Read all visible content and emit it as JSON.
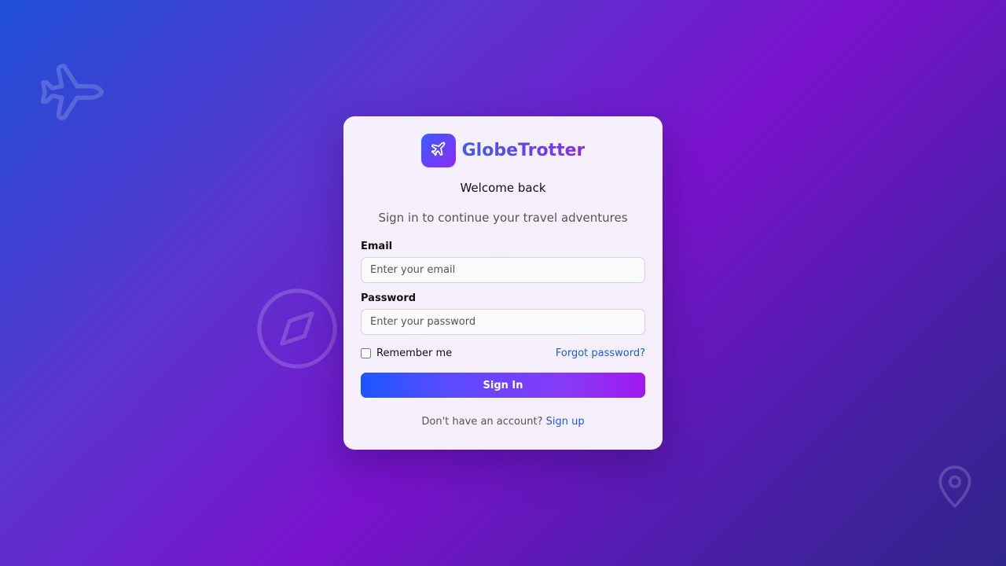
{
  "background": {
    "icons": [
      "airplane-icon",
      "compass-icon",
      "map-pin-icon"
    ],
    "gradient_colors": [
      "#1f4fd6",
      "#5a35cf",
      "#7a12cc",
      "#4a1fa8",
      "#2f2488"
    ]
  },
  "brand": {
    "name": "GlobeTrotter",
    "logo_icon": "airplane-icon",
    "gradient": [
      "#3b5cff",
      "#8b2cf5"
    ]
  },
  "heading": {
    "welcome": "Welcome back",
    "subtitle": "Sign in to continue your travel adventures"
  },
  "form": {
    "email": {
      "label": "Email",
      "value": "",
      "placeholder": "Enter your email"
    },
    "password": {
      "label": "Password",
      "value": "",
      "placeholder": "Enter your password"
    },
    "remember_me": {
      "label": "Remember me",
      "checked": false
    },
    "forgot_password": "Forgot password?",
    "submit_label": "Sign In"
  },
  "footer": {
    "prompt": "Don't have an account?",
    "signup_link": "Sign up"
  },
  "colors": {
    "link": "#1a5de0",
    "button_gradient": [
      "#1c55ff",
      "#a018ee"
    ]
  }
}
